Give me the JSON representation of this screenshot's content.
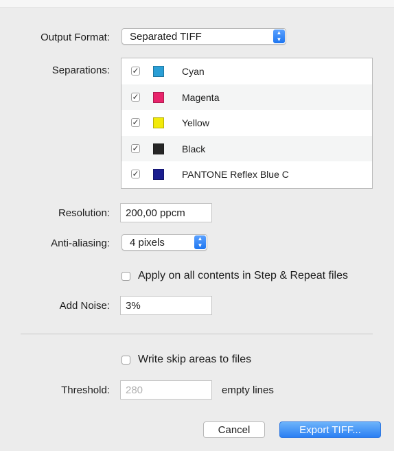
{
  "output_format": {
    "label": "Output Format:",
    "value": "Separated TIFF"
  },
  "separations": {
    "label": "Separations:",
    "items": [
      {
        "name": "Cyan",
        "checked": true,
        "color": "#2a9fd6"
      },
      {
        "name": "Magenta",
        "checked": true,
        "color": "#e8246b"
      },
      {
        "name": "Yellow",
        "checked": true,
        "color": "#f2ea0a"
      },
      {
        "name": "Black",
        "checked": true,
        "color": "#262626"
      },
      {
        "name": "PANTONE Reflex Blue C",
        "checked": true,
        "color": "#1a1d8f"
      }
    ]
  },
  "resolution": {
    "label": "Resolution:",
    "value": "200,00 ppcm"
  },
  "anti_aliasing": {
    "label": "Anti-aliasing:",
    "value": "4 pixels"
  },
  "apply_all": {
    "label": "Apply on all contents in Step & Repeat files",
    "checked": false
  },
  "add_noise": {
    "label": "Add Noise:",
    "value": "3%"
  },
  "skip_areas": {
    "label": "Write skip areas to files",
    "checked": false
  },
  "threshold": {
    "label": "Threshold:",
    "value": "280",
    "suffix": "empty lines",
    "disabled": true
  },
  "buttons": {
    "cancel": "Cancel",
    "export": "Export TIFF..."
  },
  "glyphs": {
    "check": "✓",
    "up": "▲",
    "down": "▼"
  }
}
